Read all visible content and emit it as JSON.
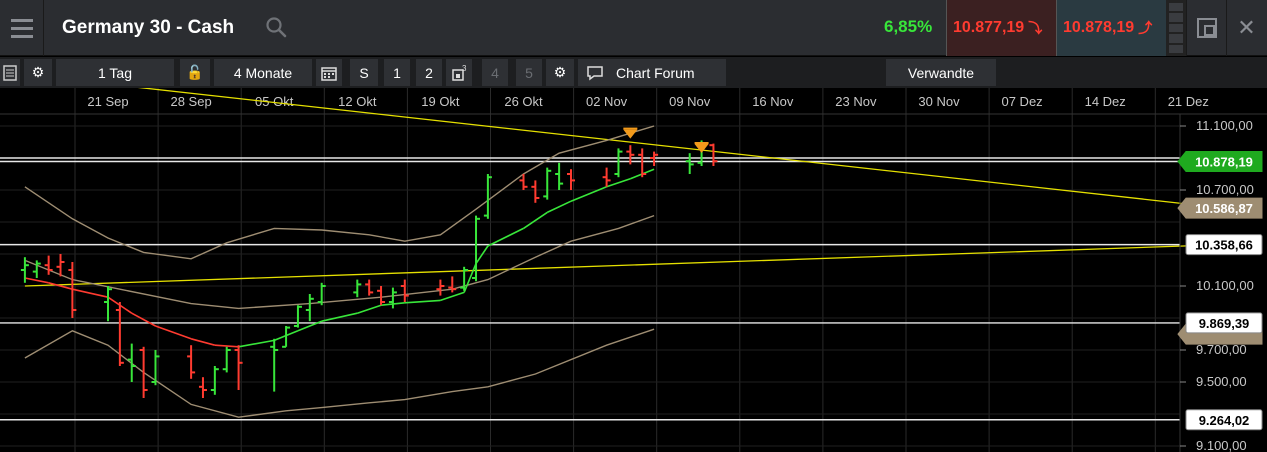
{
  "header": {
    "title": "Germany 30 - Cash",
    "change_pct": "6,85%",
    "sell_price": "10.877,19",
    "buy_price": "10.878,19"
  },
  "toolbar": {
    "interval": "1 Tag",
    "period": "4 Monate",
    "s_label": "S",
    "presets": [
      "1",
      "2",
      "3",
      "4",
      "5"
    ],
    "chart_forum": "Chart Forum",
    "related": "Verwandte"
  },
  "colors": {
    "up": "#38e63a",
    "down": "#ff3b30",
    "trendline": "#e5e000",
    "bollinger": "#9e8d72",
    "current_price_tag": "#1faa1f",
    "trend_tag": "#9e8d72"
  },
  "chart_data": {
    "type": "line",
    "x_dates": [
      "21 Sep",
      "28 Sep",
      "05 Okt",
      "12 Okt",
      "19 Okt",
      "26 Okt",
      "02 Nov",
      "09 Nov",
      "16 Nov",
      "23 Nov",
      "30 Nov",
      "07 Dez",
      "14 Dez",
      "21 Dez"
    ],
    "y_ticks": [
      "11.100,00",
      "10.700,00",
      "10.100,00",
      "9.700,00",
      "9.500,00",
      "9.100,00"
    ],
    "ylim": [
      9100,
      11200
    ],
    "price_tags": {
      "current": "10.878,19",
      "trend_upper": "10.586,87",
      "level_1": "10.358,66",
      "level_2": "9.869,39",
      "level_3": "9.264,02"
    },
    "horizontal_levels": [
      10900,
      10878.19,
      10358.66,
      9869.39,
      9264.02
    ],
    "moving_average": [
      [
        "2015-09-14",
        10150
      ],
      [
        "2015-09-16",
        10120
      ],
      [
        "2015-09-18",
        10080
      ],
      [
        "2015-09-21",
        10030
      ],
      [
        "2015-09-23",
        9930
      ],
      [
        "2015-09-25",
        9850
      ],
      [
        "2015-09-28",
        9770
      ],
      [
        "2015-09-30",
        9730
      ],
      [
        "2015-10-02",
        9720
      ],
      [
        "2015-10-05",
        9760
      ],
      [
        "2015-10-07",
        9820
      ],
      [
        "2015-10-09",
        9880
      ],
      [
        "2015-10-12",
        9930
      ],
      [
        "2015-10-14",
        9980
      ],
      [
        "2015-10-16",
        9995
      ],
      [
        "2015-10-19",
        10010
      ],
      [
        "2015-10-21",
        10060
      ],
      [
        "2015-10-22",
        10240
      ],
      [
        "2015-10-23",
        10350
      ],
      [
        "2015-10-26",
        10460
      ],
      [
        "2015-10-28",
        10560
      ],
      [
        "2015-10-30",
        10630
      ],
      [
        "2015-11-02",
        10720
      ],
      [
        "2015-11-04",
        10770
      ],
      [
        "2015-11-06",
        10830
      ]
    ],
    "bollinger_upper": [
      [
        "2015-09-14",
        10720
      ],
      [
        "2015-09-18",
        10520
      ],
      [
        "2015-09-21",
        10400
      ],
      [
        "2015-09-24",
        10310
      ],
      [
        "2015-09-28",
        10270
      ],
      [
        "2015-10-01",
        10370
      ],
      [
        "2015-10-05",
        10460
      ],
      [
        "2015-10-09",
        10450
      ],
      [
        "2015-10-13",
        10420
      ],
      [
        "2015-10-16",
        10380
      ],
      [
        "2015-10-19",
        10420
      ],
      [
        "2015-10-22",
        10580
      ],
      [
        "2015-10-26",
        10800
      ],
      [
        "2015-10-29",
        10930
      ],
      [
        "2015-11-02",
        11010
      ],
      [
        "2015-11-06",
        11100
      ]
    ],
    "bollinger_lower": [
      [
        "2015-09-14",
        9650
      ],
      [
        "2015-09-18",
        9820
      ],
      [
        "2015-09-21",
        9730
      ],
      [
        "2015-09-24",
        9560
      ],
      [
        "2015-09-28",
        9360
      ],
      [
        "2015-10-02",
        9280
      ],
      [
        "2015-10-06",
        9320
      ],
      [
        "2015-10-09",
        9340
      ],
      [
        "2015-10-13",
        9370
      ],
      [
        "2015-10-16",
        9390
      ],
      [
        "2015-10-20",
        9440
      ],
      [
        "2015-10-23",
        9470
      ],
      [
        "2015-10-27",
        9550
      ],
      [
        "2015-11-02",
        9730
      ],
      [
        "2015-11-06",
        9830
      ]
    ],
    "middle_band": [
      [
        "2015-09-14",
        10260
      ],
      [
        "2015-09-18",
        10140
      ],
      [
        "2015-09-22",
        10080
      ],
      [
        "2015-09-28",
        9990
      ],
      [
        "2015-10-02",
        9960
      ],
      [
        "2015-10-08",
        9990
      ],
      [
        "2015-10-14",
        10030
      ],
      [
        "2015-10-20",
        10080
      ],
      [
        "2015-10-23",
        10140
      ],
      [
        "2015-10-27",
        10280
      ],
      [
        "2015-10-30",
        10380
      ],
      [
        "2015-11-03",
        10460
      ],
      [
        "2015-11-06",
        10540
      ]
    ],
    "trendlines": [
      {
        "from": [
          "2015-09-14",
          11420
        ],
        "to": [
          "2015-12-24",
          10586.87
        ]
      },
      {
        "from": [
          "2015-09-14",
          10100
        ],
        "to": [
          "2015-12-24",
          10358.66
        ]
      }
    ],
    "ohlc": [
      {
        "d": "2015-09-14",
        "o": 10200,
        "h": 10280,
        "l": 10120,
        "c": 10230,
        "up": true
      },
      {
        "d": "2015-09-15",
        "o": 10190,
        "h": 10260,
        "l": 10150,
        "c": 10240,
        "up": true
      },
      {
        "d": "2015-09-16",
        "o": 10230,
        "h": 10290,
        "l": 10170,
        "c": 10200,
        "up": false
      },
      {
        "d": "2015-09-17",
        "o": 10220,
        "h": 10300,
        "l": 10160,
        "c": 10250,
        "up": false
      },
      {
        "d": "2015-09-18",
        "o": 10200,
        "h": 10250,
        "l": 9900,
        "c": 9950,
        "up": false
      },
      {
        "d": "2015-09-21",
        "o": 10000,
        "h": 10100,
        "l": 9880,
        "c": 10080,
        "up": true
      },
      {
        "d": "2015-09-22",
        "o": 9950,
        "h": 10000,
        "l": 9600,
        "c": 9620,
        "up": false
      },
      {
        "d": "2015-09-23",
        "o": 9640,
        "h": 9740,
        "l": 9500,
        "c": 9600,
        "up": true
      },
      {
        "d": "2015-09-24",
        "o": 9700,
        "h": 9720,
        "l": 9400,
        "c": 9450,
        "up": false
      },
      {
        "d": "2015-09-25",
        "o": 9500,
        "h": 9700,
        "l": 9480,
        "c": 9660,
        "up": true
      },
      {
        "d": "2015-09-28",
        "o": 9660,
        "h": 9730,
        "l": 9520,
        "c": 9560,
        "up": false
      },
      {
        "d": "2015-09-29",
        "o": 9470,
        "h": 9530,
        "l": 9400,
        "c": 9450,
        "up": false
      },
      {
        "d": "2015-09-30",
        "o": 9450,
        "h": 9600,
        "l": 9420,
        "c": 9580,
        "up": true
      },
      {
        "d": "2015-10-01",
        "o": 9580,
        "h": 9720,
        "l": 9560,
        "c": 9700,
        "up": true
      },
      {
        "d": "2015-10-02",
        "o": 9700,
        "h": 9730,
        "l": 9450,
        "c": 9620,
        "up": false
      },
      {
        "d": "2015-10-05",
        "o": 9720,
        "h": 9770,
        "l": 9440,
        "c": 9700,
        "up": true
      },
      {
        "d": "2015-10-06",
        "o": 9720,
        "h": 9850,
        "l": 9720,
        "c": 9840,
        "up": true
      },
      {
        "d": "2015-10-07",
        "o": 9850,
        "h": 9980,
        "l": 9840,
        "c": 9970,
        "up": true
      },
      {
        "d": "2015-10-08",
        "o": 9950,
        "h": 10050,
        "l": 9880,
        "c": 10020,
        "up": true
      },
      {
        "d": "2015-10-09",
        "o": 10000,
        "h": 10120,
        "l": 9980,
        "c": 10100,
        "up": true
      },
      {
        "d": "2015-10-12",
        "o": 10060,
        "h": 10140,
        "l": 10030,
        "c": 10110,
        "up": true
      },
      {
        "d": "2015-10-13",
        "o": 10110,
        "h": 10140,
        "l": 10040,
        "c": 10060,
        "up": false
      },
      {
        "d": "2015-10-14",
        "o": 10070,
        "h": 10100,
        "l": 9980,
        "c": 10000,
        "up": false
      },
      {
        "d": "2015-10-15",
        "o": 10000,
        "h": 10090,
        "l": 9960,
        "c": 10060,
        "up": true
      },
      {
        "d": "2015-10-16",
        "o": 10100,
        "h": 10140,
        "l": 10000,
        "c": 10040,
        "up": false
      },
      {
        "d": "2015-10-19",
        "o": 10080,
        "h": 10140,
        "l": 10040,
        "c": 10100,
        "up": false
      },
      {
        "d": "2015-10-20",
        "o": 10090,
        "h": 10160,
        "l": 10060,
        "c": 10080,
        "up": false
      },
      {
        "d": "2015-10-21",
        "o": 10090,
        "h": 10220,
        "l": 10070,
        "c": 10200,
        "up": true
      },
      {
        "d": "2015-10-22",
        "o": 10150,
        "h": 10540,
        "l": 10130,
        "c": 10520,
        "up": true
      },
      {
        "d": "2015-10-23",
        "o": 10540,
        "h": 10800,
        "l": 10520,
        "c": 10780,
        "up": true
      },
      {
        "d": "2015-10-26",
        "o": 10760,
        "h": 10800,
        "l": 10700,
        "c": 10720,
        "up": false
      },
      {
        "d": "2015-10-27",
        "o": 10720,
        "h": 10760,
        "l": 10620,
        "c": 10650,
        "up": false
      },
      {
        "d": "2015-10-28",
        "o": 10660,
        "h": 10840,
        "l": 10640,
        "c": 10820,
        "up": true
      },
      {
        "d": "2015-10-29",
        "o": 10800,
        "h": 10870,
        "l": 10700,
        "c": 10740,
        "up": true
      },
      {
        "d": "2015-10-30",
        "o": 10800,
        "h": 10830,
        "l": 10700,
        "c": 10760,
        "up": false
      },
      {
        "d": "2015-11-02",
        "o": 10780,
        "h": 10840,
        "l": 10720,
        "c": 10760,
        "up": false
      },
      {
        "d": "2015-11-03",
        "o": 10800,
        "h": 10960,
        "l": 10780,
        "c": 10940,
        "up": true
      },
      {
        "d": "2015-11-04",
        "o": 10940,
        "h": 10980,
        "l": 10860,
        "c": 10920,
        "up": false
      },
      {
        "d": "2015-11-05",
        "o": 10920,
        "h": 10960,
        "l": 10780,
        "c": 10800,
        "up": false
      },
      {
        "d": "2015-11-06",
        "o": 10900,
        "h": 10940,
        "l": 10850,
        "c": 10920,
        "up": false
      },
      {
        "d": "2015-11-09",
        "o": 10880,
        "h": 10930,
        "l": 10800,
        "c": 10860,
        "up": true
      },
      {
        "d": "2015-11-10",
        "o": 10870,
        "h": 11010,
        "l": 10850,
        "c": 10990,
        "up": true
      },
      {
        "d": "2015-11-11",
        "o": 10980,
        "h": 10990,
        "l": 10850,
        "c": 10880,
        "up": false
      }
    ],
    "signals": [
      {
        "d": "2015-11-04",
        "y": 11040
      },
      {
        "d": "2015-11-10",
        "y": 10950
      }
    ]
  }
}
